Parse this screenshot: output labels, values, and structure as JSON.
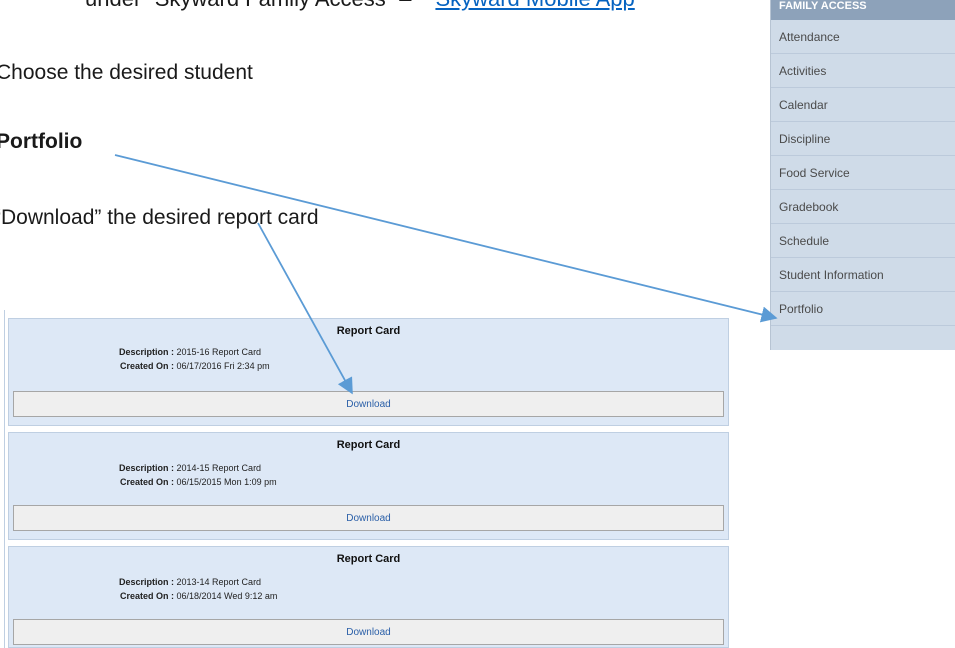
{
  "instructions": {
    "line1_prefix": "under “Skyward Family Access” –",
    "line1_link": "Skyward Mobile App",
    "line2": "Choose the desired student",
    "line3": "Portfolio",
    "line4": "“Download” the desired report card"
  },
  "sidebar": {
    "header": "FAMILY ACCESS",
    "items": [
      "Attendance",
      "Activities",
      "Calendar",
      "Discipline",
      "Food Service",
      "Gradebook",
      "Schedule",
      "Student Information",
      "Portfolio"
    ]
  },
  "report_cards": [
    {
      "title": "Report Card",
      "description_label": "Description :",
      "description": "2015-16 Report Card",
      "created_label": "Created On :",
      "created": "06/17/2016 Fri 2:34 pm",
      "download": "Download"
    },
    {
      "title": "Report Card",
      "description_label": "Description :",
      "description": "2014-15 Report Card",
      "created_label": "Created On :",
      "created": "06/15/2015 Mon 1:09 pm",
      "download": "Download"
    },
    {
      "title": "Report Card",
      "description_label": "Description :",
      "description": "2013-14 Report Card",
      "created_label": "Created On :",
      "created": "06/18/2014 Wed 9:12 am",
      "download": "Download"
    }
  ],
  "colors": {
    "arrow": "#5b9bd5",
    "card_bg": "#dde8f6",
    "sidebar_bg": "#cfdbe8",
    "sidebar_header": "#8da2ba",
    "link": "#0563c1"
  }
}
